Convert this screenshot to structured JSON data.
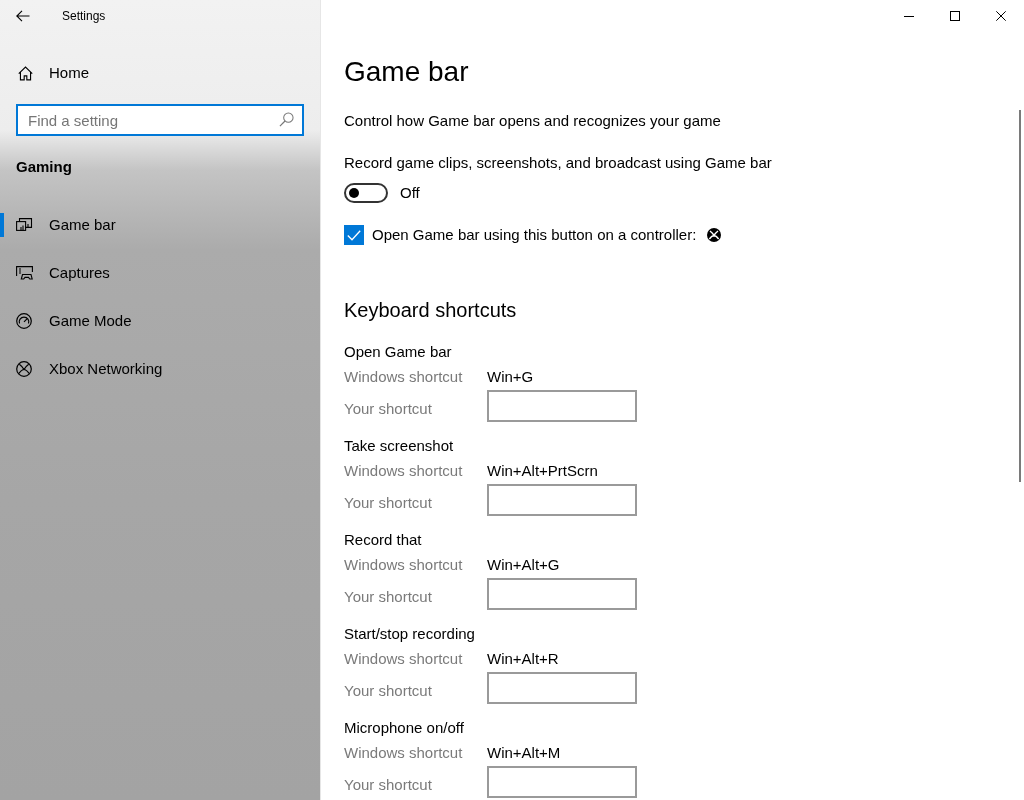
{
  "window": {
    "title": "Settings"
  },
  "sidebar": {
    "home": "Home",
    "search": {
      "placeholder": "Find a setting"
    },
    "section": "Gaming",
    "items": [
      {
        "label": "Game bar",
        "kind": "gamebar",
        "selected": true
      },
      {
        "label": "Captures",
        "kind": "captures",
        "selected": false
      },
      {
        "label": "Game Mode",
        "kind": "gamemode",
        "selected": false
      },
      {
        "label": "Xbox Networking",
        "kind": "xbox",
        "selected": false
      }
    ]
  },
  "page": {
    "title": "Game bar",
    "description": "Control how Game bar opens and recognizes your game",
    "record": {
      "label": "Record game clips, screenshots, and broadcast using Game bar",
      "on": false,
      "state_text": "Off"
    },
    "controller": {
      "label": "Open Game bar using this button on a controller:",
      "checked": true
    },
    "shortcuts": {
      "heading": "Keyboard shortcuts",
      "groups": [
        {
          "title": "Open Game bar",
          "windows_label": "Windows shortcut",
          "windows_value": "Win+G",
          "your_label": "Your shortcut"
        },
        {
          "title": "Take screenshot",
          "windows_label": "Windows shortcut",
          "windows_value": "Win+Alt+PrtScrn",
          "your_label": "Your shortcut"
        },
        {
          "title": "Record that",
          "windows_label": "Windows shortcut",
          "windows_value": "Win+Alt+G",
          "your_label": "Your shortcut"
        },
        {
          "title": "Start/stop recording",
          "windows_label": "Windows shortcut",
          "windows_value": "Win+Alt+R",
          "your_label": "Your shortcut"
        },
        {
          "title": "Microphone on/off",
          "windows_label": "Windows shortcut",
          "windows_value": "Win+Alt+M",
          "your_label": "Your shortcut"
        }
      ]
    }
  }
}
